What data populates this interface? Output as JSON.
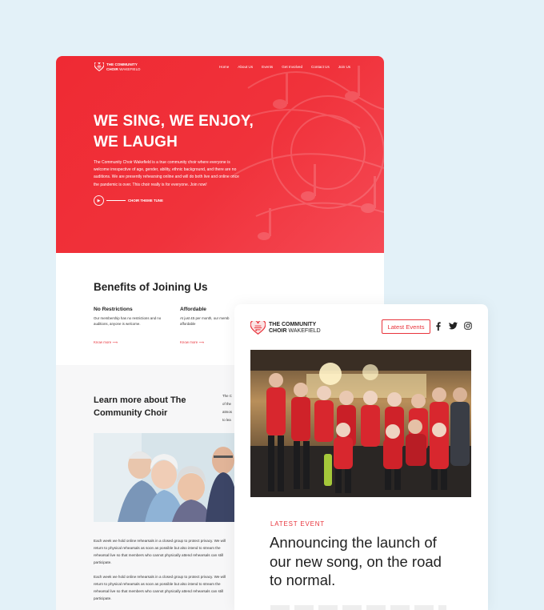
{
  "brand": {
    "line1": "THE COMMUNITY",
    "line2_bold": "CHOIR",
    "line2_light": "WAKEFIELD",
    "logo_icon": "heart-music-icon",
    "accent_color": "#e8343c"
  },
  "desktop": {
    "nav": [
      "Home",
      "About Us",
      "Events",
      "Get Involved",
      "Contact Us",
      "Join Us"
    ],
    "hero": {
      "title_line1": "WE SING, WE ENJOY,",
      "title_line2": "WE LAUGH",
      "text": "The Community Choir Wakefield is a true community choir where everyone is welcome irrespective of age, gender, ability, ethnic background, and there are no auditions. We are presently rehearsing online and will do both live and online once the pandemic is over. This choir really is for everyone. Join now!",
      "play_label": "CHOIR THEME TUNE",
      "background_color": "#ef2a33"
    },
    "benefits": {
      "title": "Benefits of Joining Us",
      "items": [
        {
          "title": "No Restrictions",
          "desc": "Our membership has no restrictions and no auditions, anyone is welcome.",
          "link": "Know more"
        },
        {
          "title": "Affordable",
          "desc": "At just £5 per month, our memb affordable",
          "link": "Know more"
        }
      ]
    },
    "learn": {
      "title": "Learn more about The Community Choir",
      "side_lines": [
        "The C",
        "of the",
        "atmos",
        "to lea"
      ],
      "paragraphs": [
        "Each week we hold online rehearsals in a closed group to protect privacy. We will return to physical rehearsals as soon as possible but also intend to stream the rehearsal live so that members who cannot physically attend rehearsals can still participate.",
        "Each week we hold online rehearsals in a closed group to protect privacy. We will return to physical rehearsals as soon as possible but also intend to stream the rehearsal live so that members who cannot physically attend rehearsals can still participate."
      ]
    }
  },
  "mobile": {
    "latest_button": "Latest Events",
    "social_icons": [
      "facebook-icon",
      "twitter-icon",
      "instagram-icon"
    ],
    "event": {
      "kicker": "LATEST EVENT",
      "title": "Announcing the launch of our new song, on the road to normal."
    }
  }
}
